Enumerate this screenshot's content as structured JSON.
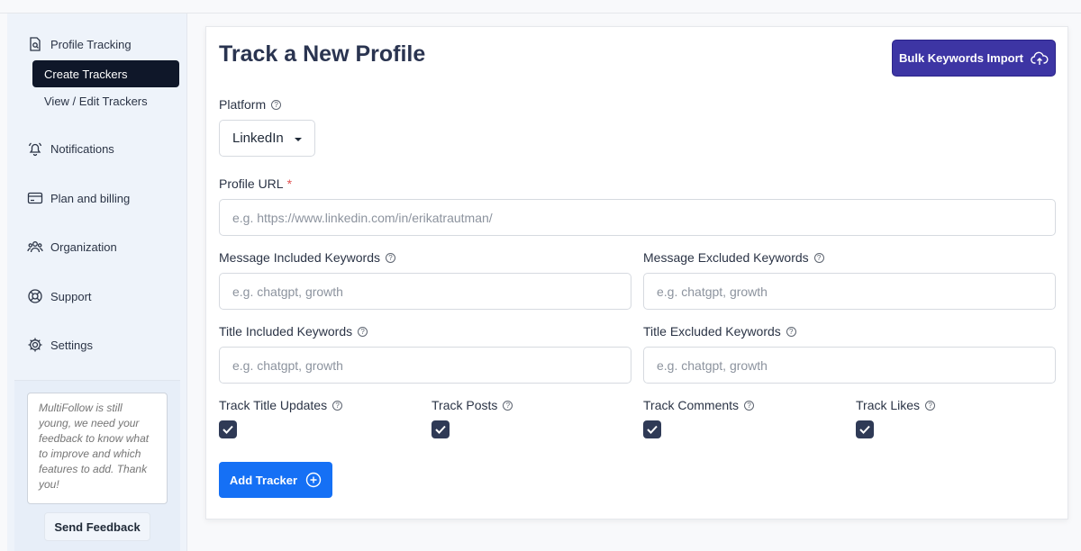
{
  "sidebar": {
    "profile_tracking": "Profile Tracking",
    "create_trackers": "Create Trackers",
    "view_edit_trackers": "View / Edit Trackers",
    "notifications": "Notifications",
    "plan_billing": "Plan and billing",
    "organization": "Organization",
    "support": "Support",
    "settings": "Settings",
    "feedback_placeholder": "MultiFollow is still young, we need your feedback to know what to improve and which features to add. Thank you!",
    "send_feedback": "Send Feedback"
  },
  "main": {
    "title": "Track a New Profile",
    "bulk_import": "Bulk Keywords Import",
    "platform_label": "Platform",
    "platform_value": "LinkedIn",
    "profile_url_label": "Profile URL",
    "profile_url_required": "*",
    "profile_url_placeholder": "e.g. https://www.linkedin.com/in/erikatrautman/",
    "msg_included_label": "Message Included Keywords",
    "msg_excluded_label": "Message Excluded Keywords",
    "title_included_label": "Title Included Keywords",
    "title_excluded_label": "Title Excluded Keywords",
    "keywords_placeholder": "e.g. chatgpt, growth",
    "track_title_updates": "Track Title Updates",
    "track_posts": "Track Posts",
    "track_comments": "Track Comments",
    "track_likes": "Track Likes",
    "add_tracker": "Add Tracker"
  },
  "colors": {
    "accent": "#1570f5",
    "bulk_button": "#3d35a4",
    "checkbox": "#2f3a56",
    "active_nav": "#0f1729"
  },
  "checkboxes": {
    "track_title_updates": true,
    "track_posts": true,
    "track_comments": true,
    "track_likes": true
  }
}
